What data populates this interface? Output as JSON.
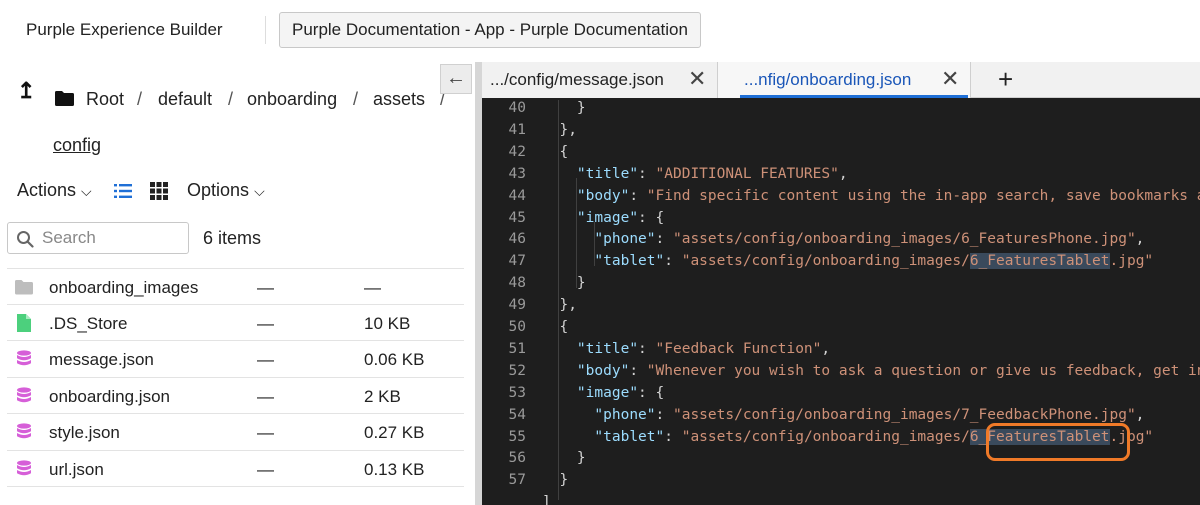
{
  "header": {
    "app_title": "Purple Experience Builder",
    "doc_button_label": "Purple Documentation - App - Purple Documentation"
  },
  "breadcrumb": {
    "items": [
      "Root",
      "default",
      "onboarding",
      "assets",
      "config"
    ],
    "separator": "/"
  },
  "toolbar": {
    "actions_label": "Actions",
    "options_label": "Options",
    "chevron": "⌄"
  },
  "search": {
    "placeholder": "Search",
    "value": "",
    "item_count": "6 items"
  },
  "files": [
    {
      "name": "onboarding_images",
      "modified": "—",
      "size": "—",
      "icon": "folder-icon",
      "color": "#bdbdbd"
    },
    {
      "name": ".DS_Store",
      "modified": "—",
      "size": "10 KB",
      "icon": "file-icon",
      "color": "#4cd07d"
    },
    {
      "name": "message.json",
      "modified": "—",
      "size": "0.06 KB",
      "icon": "database-icon",
      "color": "#d65fd8"
    },
    {
      "name": "onboarding.json",
      "modified": "—",
      "size": "2 KB",
      "icon": "database-icon",
      "color": "#d65fd8"
    },
    {
      "name": "style.json",
      "modified": "—",
      "size": "0.27 KB",
      "icon": "database-icon",
      "color": "#d65fd8"
    },
    {
      "name": "url.json",
      "modified": "—",
      "size": "0.13 KB",
      "icon": "database-icon",
      "color": "#d65fd8"
    }
  ],
  "editor": {
    "collapse_glyph": "←",
    "add_tab_glyph": "+",
    "close_glyph": "✕",
    "tabs": [
      {
        "label": ".../config/message.json",
        "active": false
      },
      {
        "label": "...nfig/onboarding.json",
        "active": true
      }
    ],
    "lines": [
      {
        "n": "40",
        "text": "    }"
      },
      {
        "n": "41",
        "text": "  },"
      },
      {
        "n": "42",
        "text": "  {"
      },
      {
        "n": "43",
        "key": "title",
        "value": "ADDITIONAL FEATURES",
        "indent": "    ",
        "tail": ","
      },
      {
        "n": "44",
        "key": "body",
        "value": "Find specific content using the in-app search, save bookmarks and ma",
        "indent": "    ",
        "tail": ""
      },
      {
        "n": "45",
        "key": "image",
        "indent": "    ",
        "open": ": {"
      },
      {
        "n": "46",
        "key": "phone",
        "value": "assets/config/onboarding_images/6_FeaturesPhone.jpg",
        "indent": "      ",
        "tail": ","
      },
      {
        "n": "47",
        "key": "tablet",
        "value_pre": "assets/config/onboarding_images/",
        "value_hl": "6_FeaturesTablet",
        "value_post": ".jpg",
        "indent": "      ",
        "tail": ""
      },
      {
        "n": "48",
        "text": "    }"
      },
      {
        "n": "49",
        "text": "  },"
      },
      {
        "n": "50",
        "text": "  {"
      },
      {
        "n": "51",
        "key": "title",
        "value": "Feedback Function",
        "indent": "    ",
        "tail": ","
      },
      {
        "n": "52",
        "key": "body",
        "value": "Whenever you wish to ask a question or give us feedback, get in touc",
        "indent": "    ",
        "tail": ""
      },
      {
        "n": "53",
        "key": "image",
        "indent": "    ",
        "open": ": {"
      },
      {
        "n": "54",
        "key": "phone",
        "value": "assets/config/onboarding_images/7_FeedbackPhone.jpg",
        "indent": "      ",
        "tail": ","
      },
      {
        "n": "55",
        "key": "tablet",
        "value_pre": "assets/config/onboarding_images/",
        "value_hl": "6_FeaturesTablet",
        "value_post": ".jpg",
        "indent": "      ",
        "tail": ""
      },
      {
        "n": "56",
        "text": "    }"
      },
      {
        "n": "57",
        "text": "  }"
      },
      {
        "n": "",
        "text": "]"
      }
    ]
  },
  "colors": {
    "accent": "#1f6fd6",
    "highlight_outline": "#f07a28",
    "editor_bg": "#1e1e1e"
  }
}
